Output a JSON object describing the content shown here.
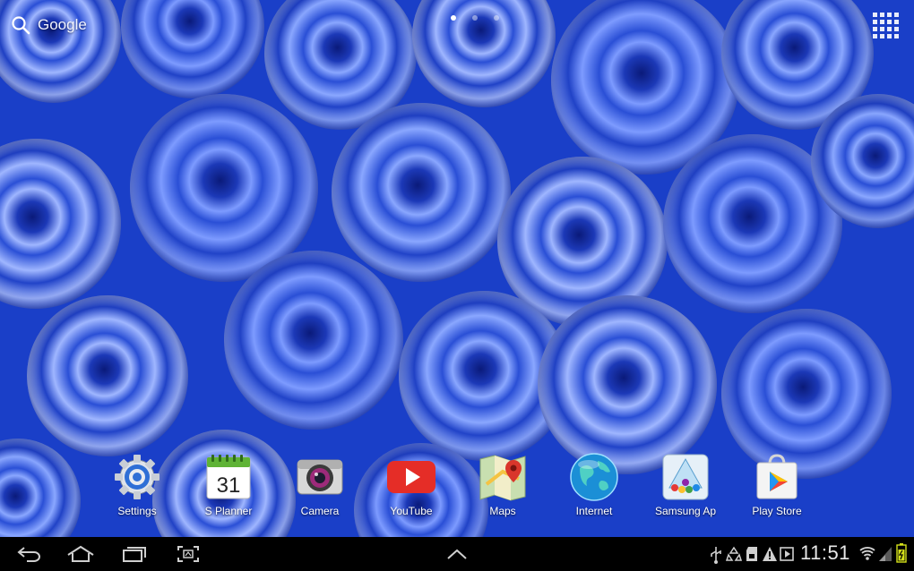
{
  "search": {
    "label": "Google"
  },
  "page_indicator": {
    "pages": 3,
    "active": 0
  },
  "dock": {
    "apps": [
      {
        "label": "Settings",
        "icon": "settings-gear-icon"
      },
      {
        "label": "S Planner",
        "icon": "calendar-icon",
        "date": "31"
      },
      {
        "label": "Camera",
        "icon": "camera-icon"
      },
      {
        "label": "YouTube",
        "icon": "youtube-icon"
      },
      {
        "label": "Maps",
        "icon": "maps-icon"
      },
      {
        "label": "Internet",
        "icon": "globe-icon"
      },
      {
        "label": "Samsung Ap",
        "icon": "samsung-apps-icon"
      },
      {
        "label": "Play Store",
        "icon": "play-store-icon"
      }
    ]
  },
  "nav": {
    "back": "back-icon",
    "home": "home-icon",
    "recent": "recent-apps-icon",
    "screenshot": "screen-capture-icon",
    "up": "chevron-up-icon"
  },
  "status": {
    "time": "11:51",
    "icons": [
      "usb-icon",
      "recycle-icon",
      "sd-card-icon",
      "warning-icon",
      "play-icon",
      "wifi-icon",
      "signal-icon",
      "battery-icon"
    ]
  },
  "colors": {
    "wallpaper": "#1a3fc8",
    "nav_bar": "#000000",
    "youtube": "#e52d27",
    "battery": "#d4e01a"
  }
}
